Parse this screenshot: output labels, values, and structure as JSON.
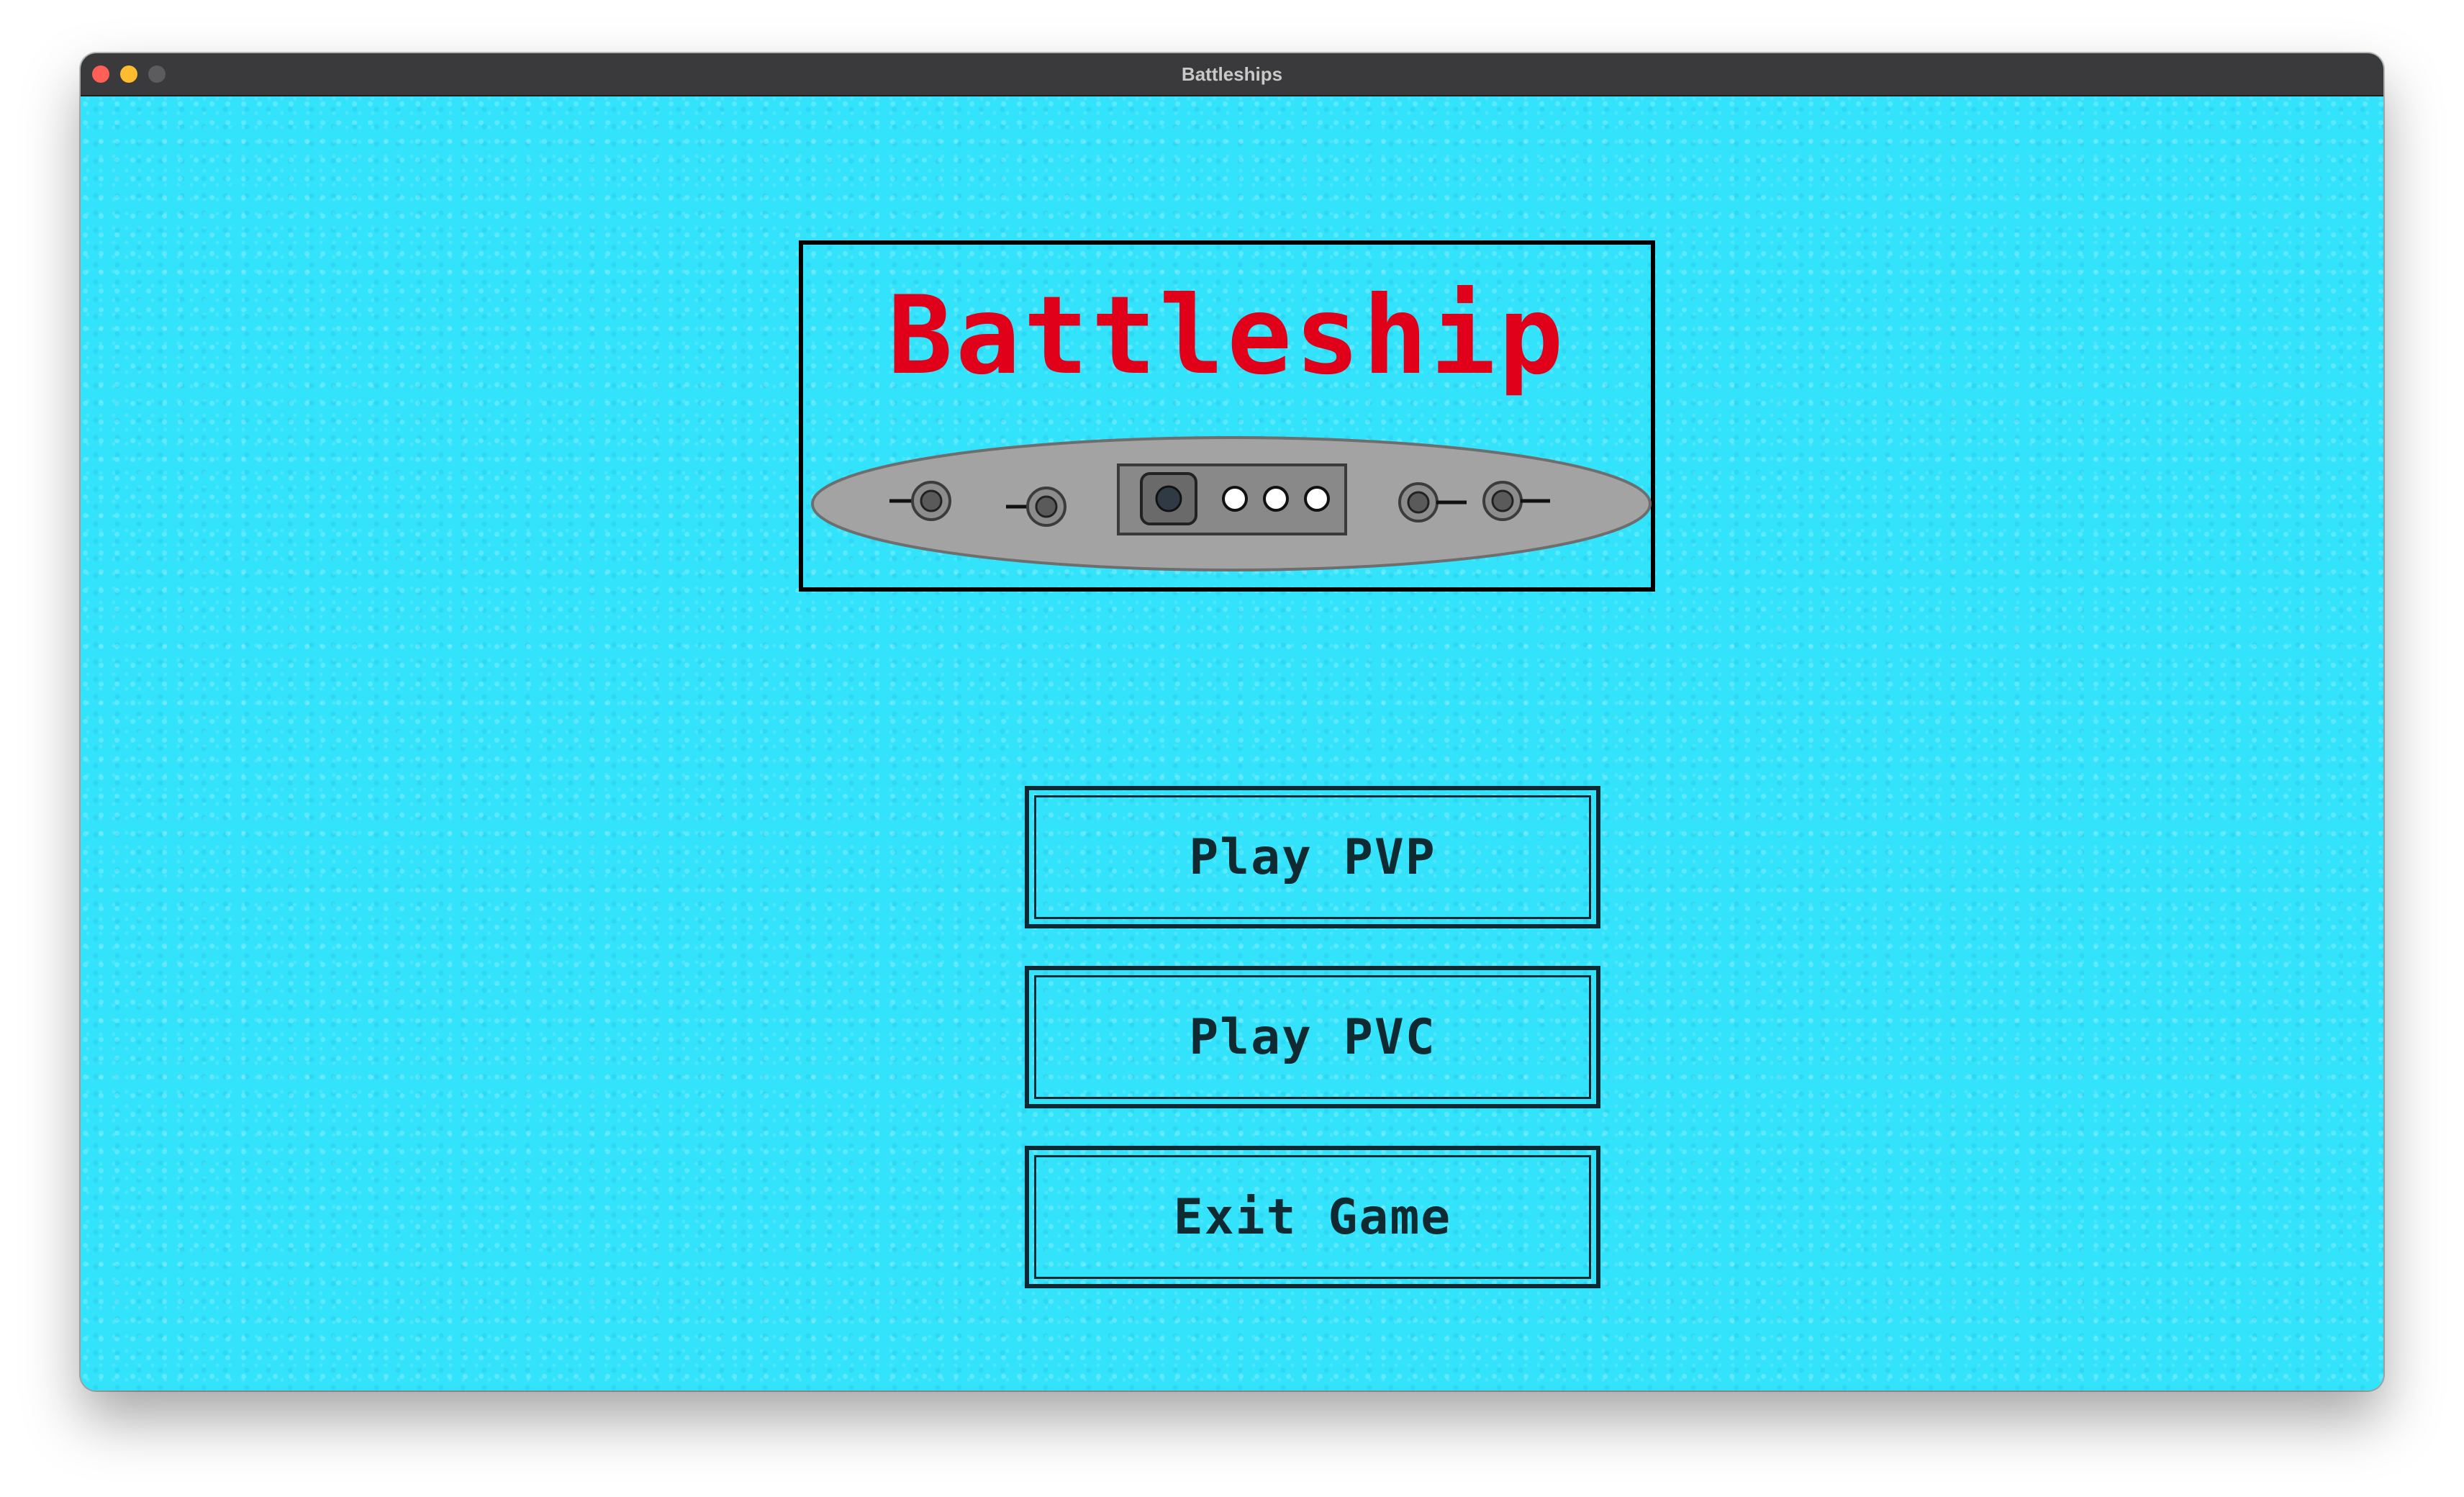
{
  "window": {
    "title": "Battleships"
  },
  "logo": {
    "title": "Battleship",
    "title_color": "#e0001a",
    "ship_icon": "battleship-icon"
  },
  "menu": {
    "buttons": [
      {
        "label": "Play PVP"
      },
      {
        "label": "Play PVC"
      },
      {
        "label": "Exit Game"
      }
    ]
  },
  "colors": {
    "sea": "#33e3fb",
    "border": "#000000",
    "ship_hull": "#a3a3a3"
  }
}
